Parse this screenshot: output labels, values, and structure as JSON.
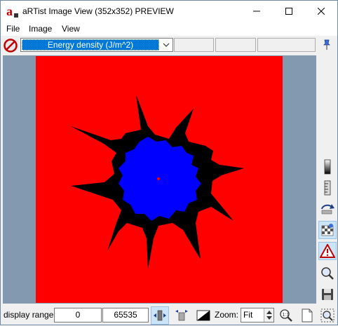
{
  "window": {
    "title": "aRTist Image View (352x352) PREVIEW",
    "app_icon_letter": "a"
  },
  "menu": {
    "items": [
      "File",
      "Image",
      "View"
    ]
  },
  "toolbar": {
    "quantity_select": "Energy density (J/m^2)"
  },
  "image": {
    "background_color": "#ff0000",
    "outer_shape_color": "#000000",
    "inner_shape_color": "#0000ff",
    "center_marker_color": "#ff0000"
  },
  "bottom": {
    "display_range_label": "display range",
    "range_min": "0",
    "range_max": "65535",
    "zoom_label": "Zoom:",
    "zoom_value": "Fit"
  },
  "colors": {
    "viewport_bg": "#8399af",
    "selection": "#0078d7",
    "active_tool_bg": "#cce4f7"
  }
}
